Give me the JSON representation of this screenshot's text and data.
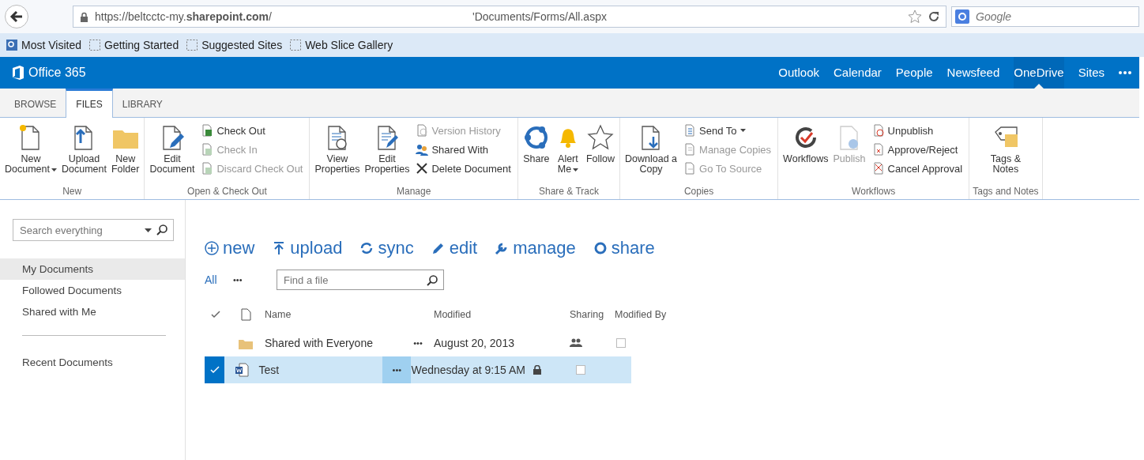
{
  "browser": {
    "url": "https://beltcctc-my.**sharepoint.com**/",
    "url_tail": "'Documents/Forms/All.aspx",
    "search_placeholder": "Google"
  },
  "bookmarks": [
    {
      "label": "Most Visited",
      "kind": "feed"
    },
    {
      "label": "Getting Started",
      "kind": "slice"
    },
    {
      "label": "Suggested Sites",
      "kind": "slice"
    },
    {
      "label": "Web Slice Gallery",
      "kind": "slice"
    }
  ],
  "suite_bar": {
    "brand": "Office 365",
    "links": [
      {
        "label": "Outlook",
        "selected": false
      },
      {
        "label": "Calendar",
        "selected": false
      },
      {
        "label": "People",
        "selected": false
      },
      {
        "label": "Newsfeed",
        "selected": false
      },
      {
        "label": "OneDrive",
        "selected": true
      },
      {
        "label": "Sites",
        "selected": false
      }
    ]
  },
  "ribbon_tabs": [
    {
      "label": "BROWSE",
      "selected": false
    },
    {
      "label": "FILES",
      "selected": true
    },
    {
      "label": "LIBRARY",
      "selected": false
    }
  ],
  "ribbon_groups": [
    {
      "name": "New",
      "items": [
        {
          "label": "New\nDocument",
          "kind": "large",
          "disabled": false,
          "dropdown": true
        },
        {
          "label": "Upload\nDocument",
          "kind": "large",
          "disabled": false,
          "dropdown": false
        },
        {
          "label": "New\nFolder",
          "kind": "large",
          "disabled": false,
          "dropdown": false
        }
      ]
    },
    {
      "name": "Open & Check Out",
      "items": [
        {
          "label": "Edit\nDocument",
          "kind": "large",
          "disabled": false,
          "dropdown": false
        },
        {
          "label": "Check Out",
          "kind": "small",
          "disabled": false,
          "dropdown": false
        },
        {
          "label": "Check In",
          "kind": "small",
          "disabled": true,
          "dropdown": false
        },
        {
          "label": "Discard Check Out",
          "kind": "small",
          "disabled": true,
          "dropdown": false
        }
      ]
    },
    {
      "name": "Manage",
      "items": [
        {
          "label": "View\nProperties",
          "kind": "large",
          "disabled": false,
          "dropdown": false
        },
        {
          "label": "Edit\nProperties",
          "kind": "large",
          "disabled": false,
          "dropdown": false
        },
        {
          "label": "Version History",
          "kind": "small",
          "disabled": true,
          "dropdown": false
        },
        {
          "label": "Shared With",
          "kind": "small",
          "disabled": false,
          "dropdown": false
        },
        {
          "label": "Delete Document",
          "kind": "small",
          "disabled": false,
          "dropdown": false
        }
      ]
    },
    {
      "name": "Share & Track",
      "items": [
        {
          "label": "Share",
          "kind": "large",
          "disabled": false,
          "dropdown": false
        },
        {
          "label": "Alert\nMe",
          "kind": "large",
          "disabled": false,
          "dropdown": true
        },
        {
          "label": "Follow",
          "kind": "large",
          "disabled": false,
          "dropdown": false
        }
      ]
    },
    {
      "name": "Copies",
      "items": [
        {
          "label": "Download a\nCopy",
          "kind": "large",
          "disabled": false,
          "dropdown": false
        },
        {
          "label": "Send To",
          "kind": "small",
          "disabled": false,
          "dropdown": true
        },
        {
          "label": "Manage Copies",
          "kind": "small",
          "disabled": true,
          "dropdown": false
        },
        {
          "label": "Go To Source",
          "kind": "small",
          "disabled": true,
          "dropdown": false
        }
      ]
    },
    {
      "name": "Workflows",
      "items": [
        {
          "label": "Workflows",
          "kind": "large",
          "disabled": false,
          "dropdown": false
        },
        {
          "label": "Publish",
          "kind": "large",
          "disabled": true,
          "dropdown": false
        },
        {
          "label": "Unpublish",
          "kind": "small",
          "disabled": false,
          "dropdown": false
        },
        {
          "label": "Approve/Reject",
          "kind": "small",
          "disabled": false,
          "dropdown": false
        },
        {
          "label": "Cancel Approval",
          "kind": "small",
          "disabled": false,
          "dropdown": false
        }
      ]
    },
    {
      "name": "Tags and Notes",
      "items": [
        {
          "label": "Tags &\nNotes",
          "kind": "large",
          "disabled": false,
          "dropdown": false
        }
      ]
    }
  ],
  "left_nav": {
    "search_placeholder": "Search everything",
    "items": [
      {
        "label": "My Documents",
        "selected": true
      },
      {
        "label": "Followed Documents",
        "selected": false
      },
      {
        "label": "Shared with Me",
        "selected": false
      }
    ],
    "recent_heading": "Recent Documents"
  },
  "commands": [
    "new",
    "upload",
    "sync",
    "edit",
    "manage",
    "share"
  ],
  "view": {
    "label": "All",
    "more": "•••",
    "find_placeholder": "Find a file"
  },
  "table": {
    "columns": [
      "Name",
      "Modified",
      "Sharing",
      "Modified By"
    ],
    "rows": [
      {
        "name": "Shared with Everyone",
        "kind": "folder",
        "more": "•••",
        "modified": "August 20, 2013",
        "shared": true,
        "selected": false
      },
      {
        "name": "Test",
        "kind": "word",
        "more": "•••",
        "modified": "Wednesday at 9:15 AM",
        "shared": false,
        "selected": true
      }
    ]
  }
}
